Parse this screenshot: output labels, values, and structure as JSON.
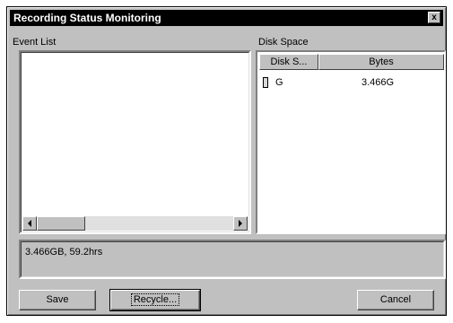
{
  "window": {
    "title": "Recording Status Monitoring",
    "close_label": "x"
  },
  "event_list": {
    "label": "Event List"
  },
  "disk_space": {
    "label": "Disk Space",
    "columns": [
      "Disk S...",
      "Bytes"
    ],
    "rows": [
      {
        "disk": "G",
        "bytes": "3.466G"
      }
    ]
  },
  "status": {
    "text": "3.466GB, 59.2hrs"
  },
  "buttons": {
    "save": "Save",
    "recycle": "Recycle...",
    "cancel": "Cancel"
  }
}
